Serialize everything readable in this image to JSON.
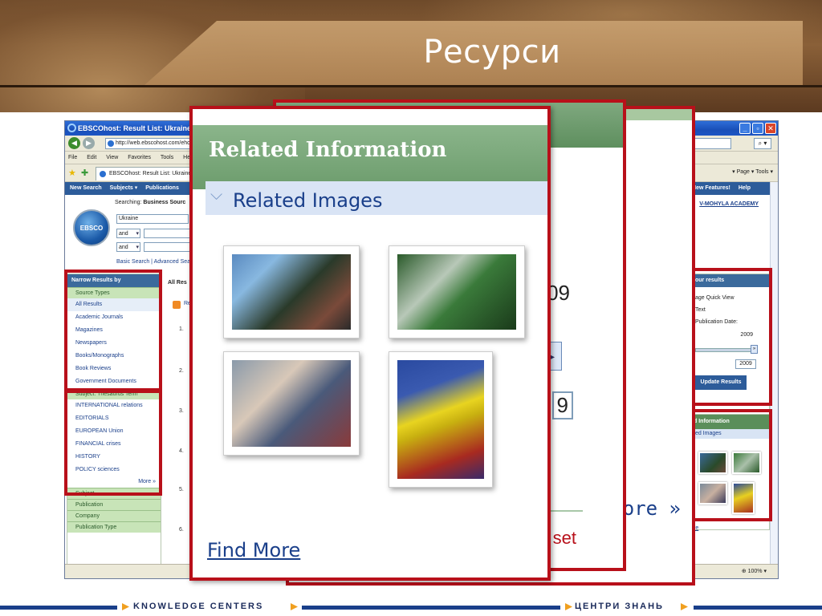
{
  "slide": {
    "title": "Ресурси"
  },
  "browser": {
    "window_title": "EBSCOhost: Result List: Ukraine - Win",
    "url": "http://web.ebscohost.com/ehost",
    "menu": [
      "File",
      "Edit",
      "View",
      "Favorites",
      "Tools",
      "Help"
    ],
    "tab_title": "EBSCOhost: Result List: Ukraine",
    "tools_right": "▾ Page ▾ Tools ▾",
    "zoom": "100%"
  },
  "ebsco": {
    "nav": [
      "New Search",
      "Subjects ▾",
      "Publications"
    ],
    "nav_right": [
      "New Features!",
      "Help"
    ],
    "academy": "V-MOHYLA ACADEMY",
    "logo_text": "EBSCO",
    "searching_label": "Searching:",
    "searching_db": "Business Sourc",
    "query": "Ukraine",
    "bool1": "and",
    "bool2": "and",
    "search_links": "Basic Search | Advanced Sea",
    "narrow_title": "Narrow Results by",
    "source_types_head": "Source Types",
    "source_types": [
      "All Results",
      "Academic Journals",
      "Magazines",
      "Newspapers",
      "Books/Monographs",
      "Book Reviews",
      "Government Documents"
    ],
    "thesaurus_head": "Subject: Thesaurus Term",
    "thesaurus_terms": [
      "INTERNATIONAL relations",
      "EDITORIALS",
      "EUROPEAN Union",
      "FINANCIAL crises",
      "HISTORY",
      "POLICY sciences"
    ],
    "more": "More »",
    "other_facets": [
      "Subject",
      "Publication",
      "Company",
      "Publication Type"
    ],
    "results_head": "All Res",
    "rss_label": "Re",
    "result_numbers": [
      "1.",
      "2.",
      "3.",
      "4.",
      "5.",
      "6."
    ],
    "refine": {
      "title": "our results",
      "lines": [
        "age Quick View",
        "Text",
        "Publication Date:"
      ],
      "year": "2009",
      "year_input": "2009",
      "slider_btn": "»",
      "update": "Update Results"
    },
    "related_small": {
      "title": "d Information",
      "sub": "ted Images",
      "more": "re"
    }
  },
  "zoom_cards": {
    "main_title": "Related Information",
    "main_subtitle": "Related Images",
    "find_more": "Find More",
    "back_year": "09",
    "back_year_input": "9",
    "back_reset": "set",
    "back_more": "ore »",
    "slider_glyph": "◂▸"
  },
  "footer": {
    "left": "KNOWLEDGE CENTERS",
    "right": "ЦЕНТРИ ЗНАНЬ",
    "brand_color": "#1a3f8a",
    "accent_color": "#f0a020"
  },
  "highlight_color": "#b8101a"
}
